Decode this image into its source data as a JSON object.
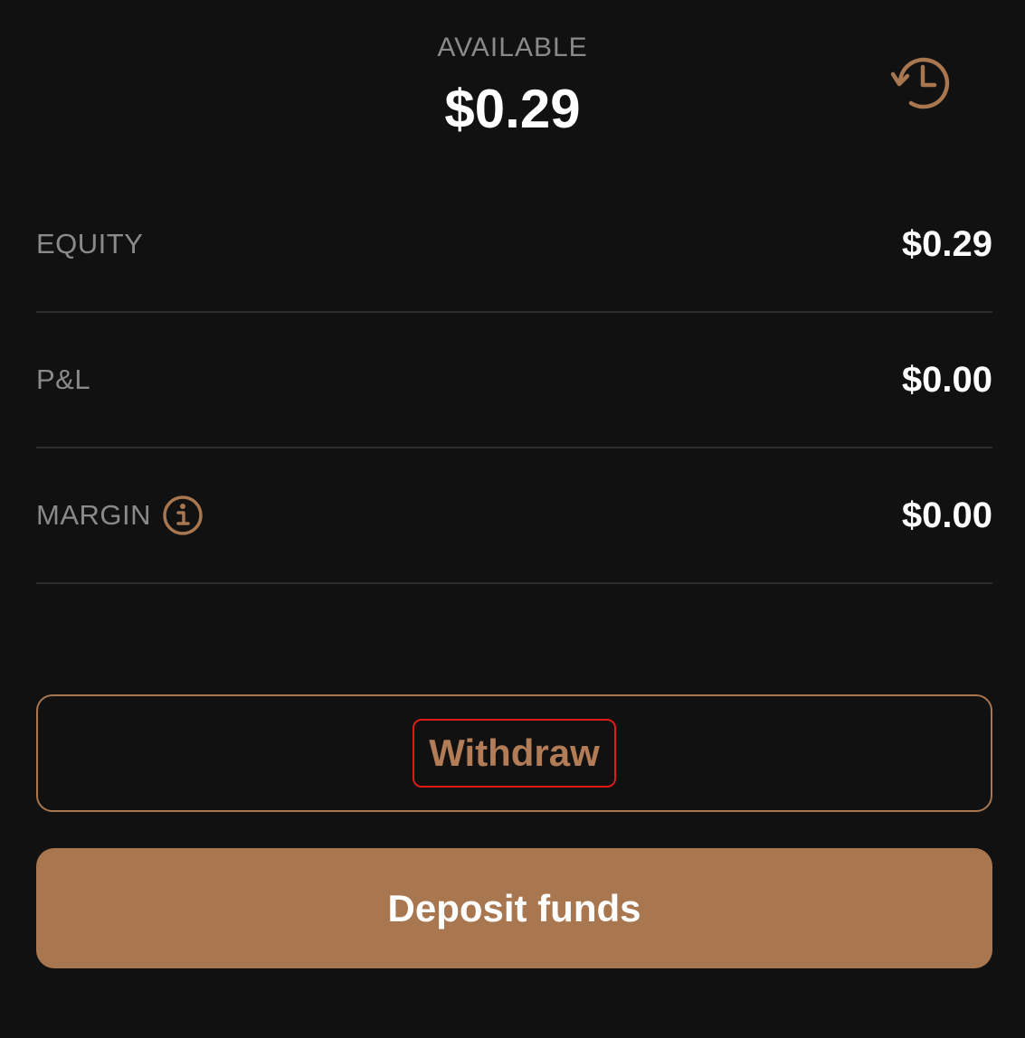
{
  "header": {
    "available_label": "AVAILABLE",
    "available_amount": "$0.29",
    "history_icon": "history-clock-icon"
  },
  "rows": [
    {
      "label": "EQUITY",
      "value": "$0.29"
    },
    {
      "label": "P&L",
      "value": "$0.00"
    },
    {
      "label": "MARGIN",
      "value": "$0.00",
      "info_icon": "info-icon"
    }
  ],
  "actions": {
    "withdraw_label": "Withdraw",
    "deposit_label": "Deposit funds"
  },
  "colors": {
    "background": "#111111",
    "accent": "#a8764f",
    "label_gray": "#8a8a8a",
    "divider": "#2c2c2c",
    "highlight_outline": "#e01a1a"
  }
}
